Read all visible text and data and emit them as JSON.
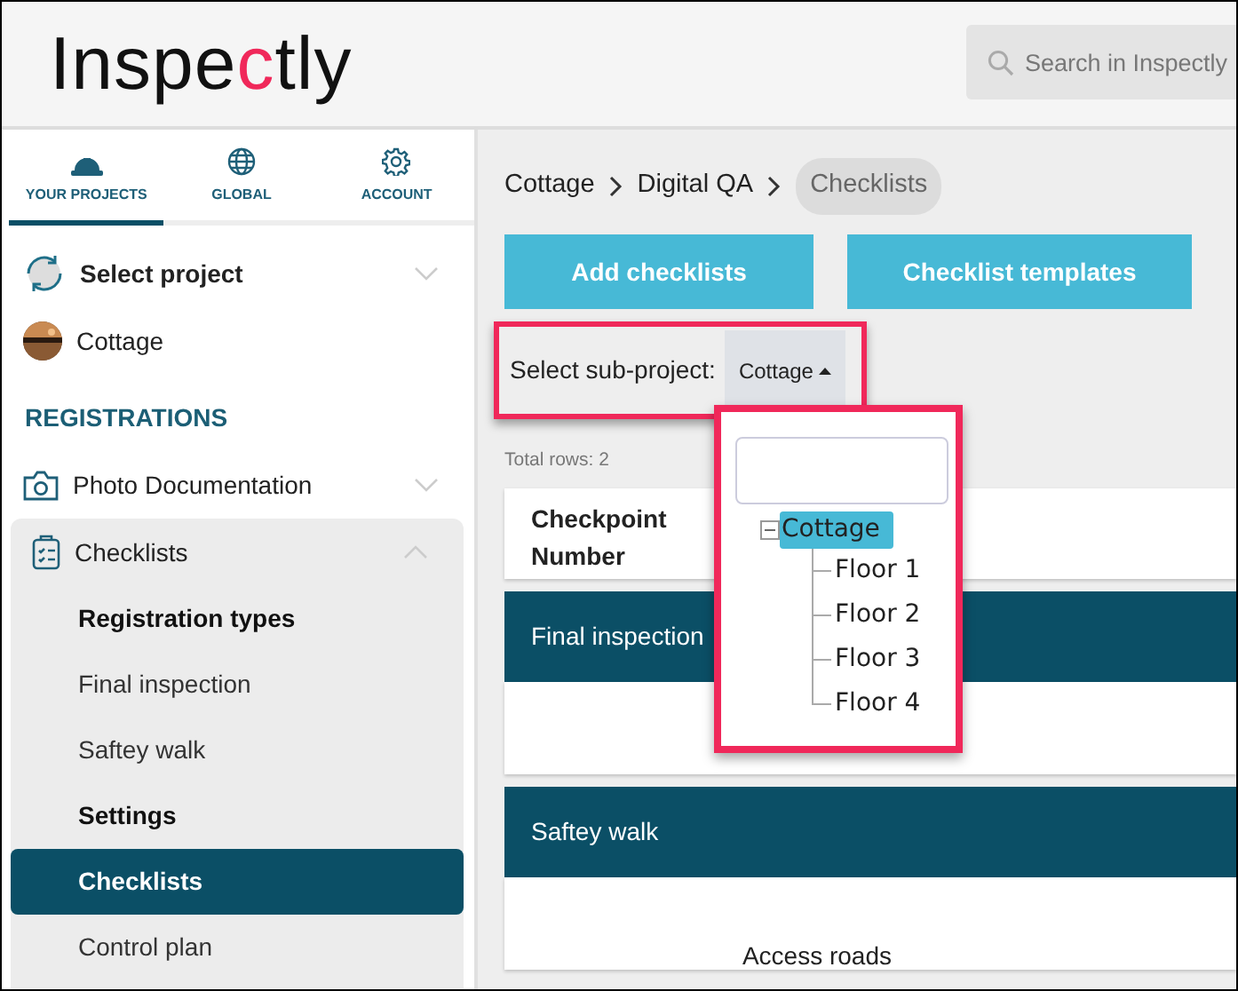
{
  "logo": {
    "parts": [
      {
        "text": "Inspe",
        "color": "#111111"
      },
      {
        "text": "c",
        "color": "#f0285a"
      },
      {
        "text": "tly",
        "color": "#111111"
      }
    ]
  },
  "search": {
    "placeholder": "Search in Inspectly"
  },
  "sidebar_tabs": [
    {
      "label": "YOUR PROJECTS",
      "selected": true
    },
    {
      "label": "GLOBAL",
      "selected": false
    },
    {
      "label": "ACCOUNT",
      "selected": false
    }
  ],
  "project_select": {
    "label": "Select project",
    "expanded": false
  },
  "project": {
    "name": "Cottage"
  },
  "section_title": "REGISTRATIONS",
  "menu": [
    {
      "label": "Photo Documentation",
      "expanded": false
    },
    {
      "label": "Checklists",
      "expanded": true,
      "children": [
        {
          "label": "Registration types",
          "kind": "heading"
        },
        {
          "label": "Final inspection",
          "kind": "link",
          "selected": false
        },
        {
          "label": "Saftey walk",
          "kind": "link",
          "selected": false
        },
        {
          "label": "Settings",
          "kind": "heading"
        },
        {
          "label": "Checklists",
          "kind": "link",
          "selected": true
        },
        {
          "label": "Control plan",
          "kind": "link",
          "selected": false
        }
      ]
    }
  ],
  "breadcrumb": [
    {
      "label": "Cottage",
      "current": false
    },
    {
      "label": "Digital QA",
      "current": false
    },
    {
      "label": "Checklists",
      "current": true
    }
  ],
  "buttons": [
    "Add checklists",
    "Checklist templates"
  ],
  "subproject": {
    "label": "Select sub-project:",
    "value": "Cottage",
    "expanded": true,
    "highlighted": true
  },
  "dropdown": {
    "highlighted": true,
    "tree": [
      {
        "label": "Cottage",
        "selected": true,
        "expanded": true,
        "children": [
          {
            "label": "Floor 1",
            "selected": false
          },
          {
            "label": "Floor 2",
            "selected": false
          },
          {
            "label": "Floor 3",
            "selected": false
          },
          {
            "label": "Floor 4",
            "selected": false
          }
        ]
      }
    ]
  },
  "total_rows": "Total rows: 2",
  "table": {
    "columns": [
      "Checkpoint Number"
    ],
    "groups": [
      {
        "title": "Final inspection"
      },
      {
        "title": "Saftey walk",
        "rows": [
          "Access roads"
        ]
      }
    ]
  }
}
